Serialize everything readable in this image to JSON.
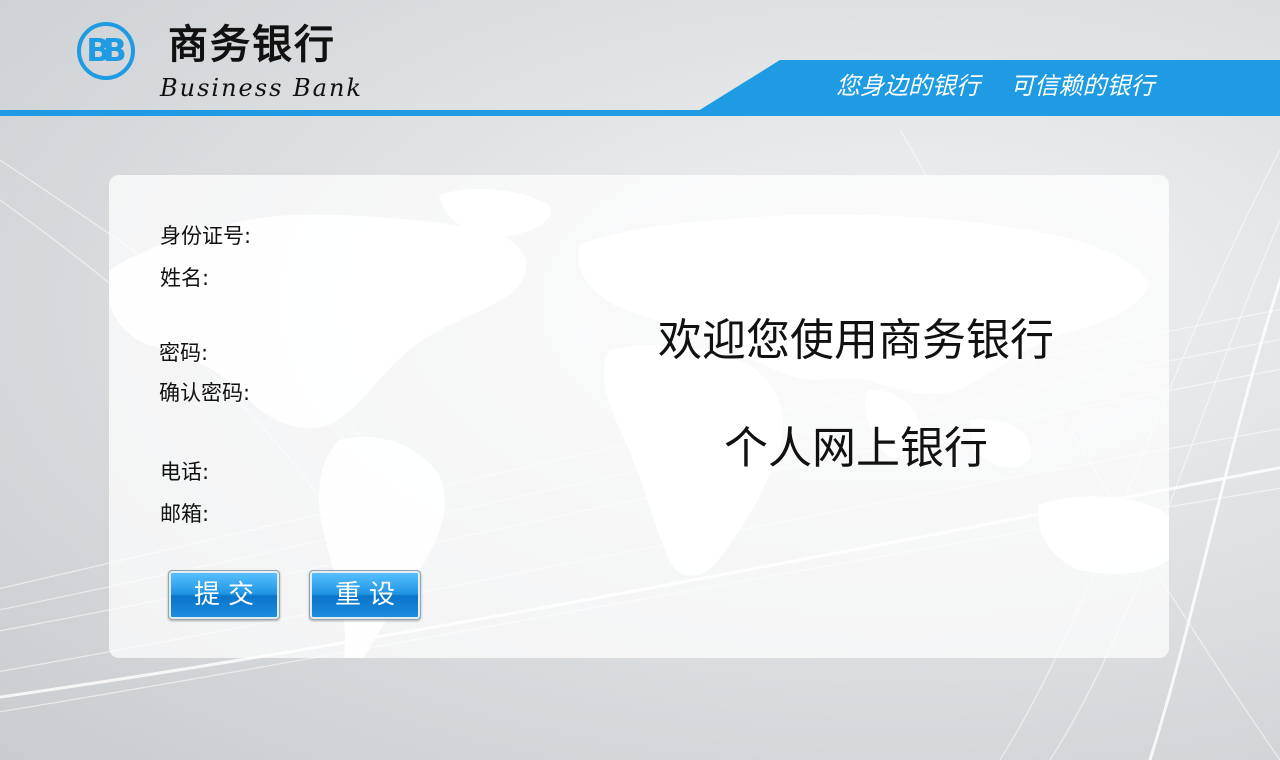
{
  "header": {
    "logo_mark": "BB",
    "brand_cn": "商务银行",
    "brand_en": "Business Bank",
    "slogan": "您身边的银行    可信赖的银行"
  },
  "form": {
    "fields": [
      {
        "label": "身份证号:"
      },
      {
        "label": "姓名:"
      },
      {
        "label": "密码:"
      },
      {
        "label": "确认密码:"
      },
      {
        "label": "电话:"
      },
      {
        "label": "邮箱:"
      }
    ],
    "submit_label": "提交",
    "reset_label": "重设"
  },
  "welcome": {
    "line1": "欢迎您使用商务银行",
    "line2": "个人网上银行"
  },
  "colors": {
    "accent": "#1e9be3",
    "button_top": "#5cc3ff",
    "button_bottom": "#0a74c9"
  }
}
